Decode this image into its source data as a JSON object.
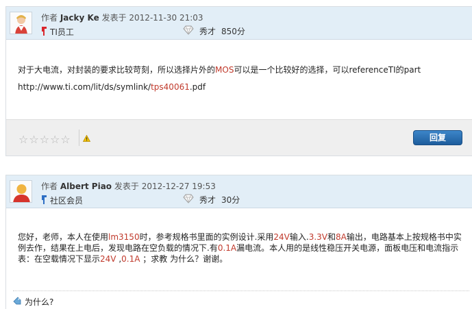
{
  "posts": [
    {
      "author_prefix": "作者",
      "author": "Jacky Ke",
      "posted_label": "发表于",
      "timestamp": "2012-11-30 21:03",
      "role": "TI员工",
      "rank_title": "秀才",
      "points": "850分",
      "body_line1_a": "对于大电流，对封装的要求比较苛刻，所以选择片外的",
      "body_line1_b": "MOS",
      "body_line1_c": "可以是一个比较好的选择，可以referenceTI的part",
      "body_link_a": "http://www.ti.com/lit/ds/symlink/",
      "body_link_b": "tps40061",
      "body_link_c": ".pdf",
      "reply_label": "回复"
    },
    {
      "author_prefix": "作者",
      "author": "Albert Piao",
      "posted_label": "发表于",
      "timestamp": "2012-12-27 19:53",
      "role": "社区会员",
      "rank_title": "秀才",
      "points": "30分",
      "body": [
        {
          "t": "您好，老师，本人在使用",
          "red": false
        },
        {
          "t": "lm3150",
          "red": true
        },
        {
          "t": "时，参考规格书里面的实例设计.采用",
          "red": false
        },
        {
          "t": "24V",
          "red": true
        },
        {
          "t": "输入.",
          "red": false
        },
        {
          "t": "3.3V",
          "red": true
        },
        {
          "t": "和",
          "red": false
        },
        {
          "t": "8A",
          "red": true
        },
        {
          "t": "输出，电路基本上按规格书中实例去作，结果在上电后，发现电路在空负载的情况下.有",
          "red": false
        },
        {
          "t": "0.1A",
          "red": true
        },
        {
          "t": "漏电流。本人用的是线性稳压开关电源，面板电压和电流指示表：在空载情况下显示",
          "red": false
        },
        {
          "t": "24V",
          "red": true
        },
        {
          "t": " ,",
          "red": false
        },
        {
          "t": "0.1A",
          "red": true
        },
        {
          "t": " ；求教 为什么？谢谢。",
          "red": false
        }
      ],
      "tag": "为什么?"
    }
  ]
}
